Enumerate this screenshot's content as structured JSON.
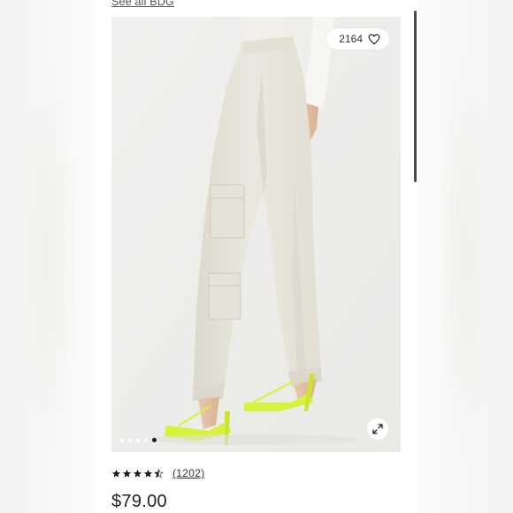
{
  "header": {
    "see_all_link": "See all BDG"
  },
  "product_image": {
    "favorite_count": "2164",
    "favorite_icon": "heart-icon",
    "zoom_icon": "expand-icon",
    "carousel": {
      "total_dots": 5,
      "active_index": 4
    }
  },
  "rating": {
    "stars": 4.5,
    "review_count": "(1202)"
  },
  "price": "$79.00",
  "colors": {
    "accent_shoe": "#d7f23a",
    "pants": "#e9e6dc",
    "image_bg": "#efefec"
  }
}
